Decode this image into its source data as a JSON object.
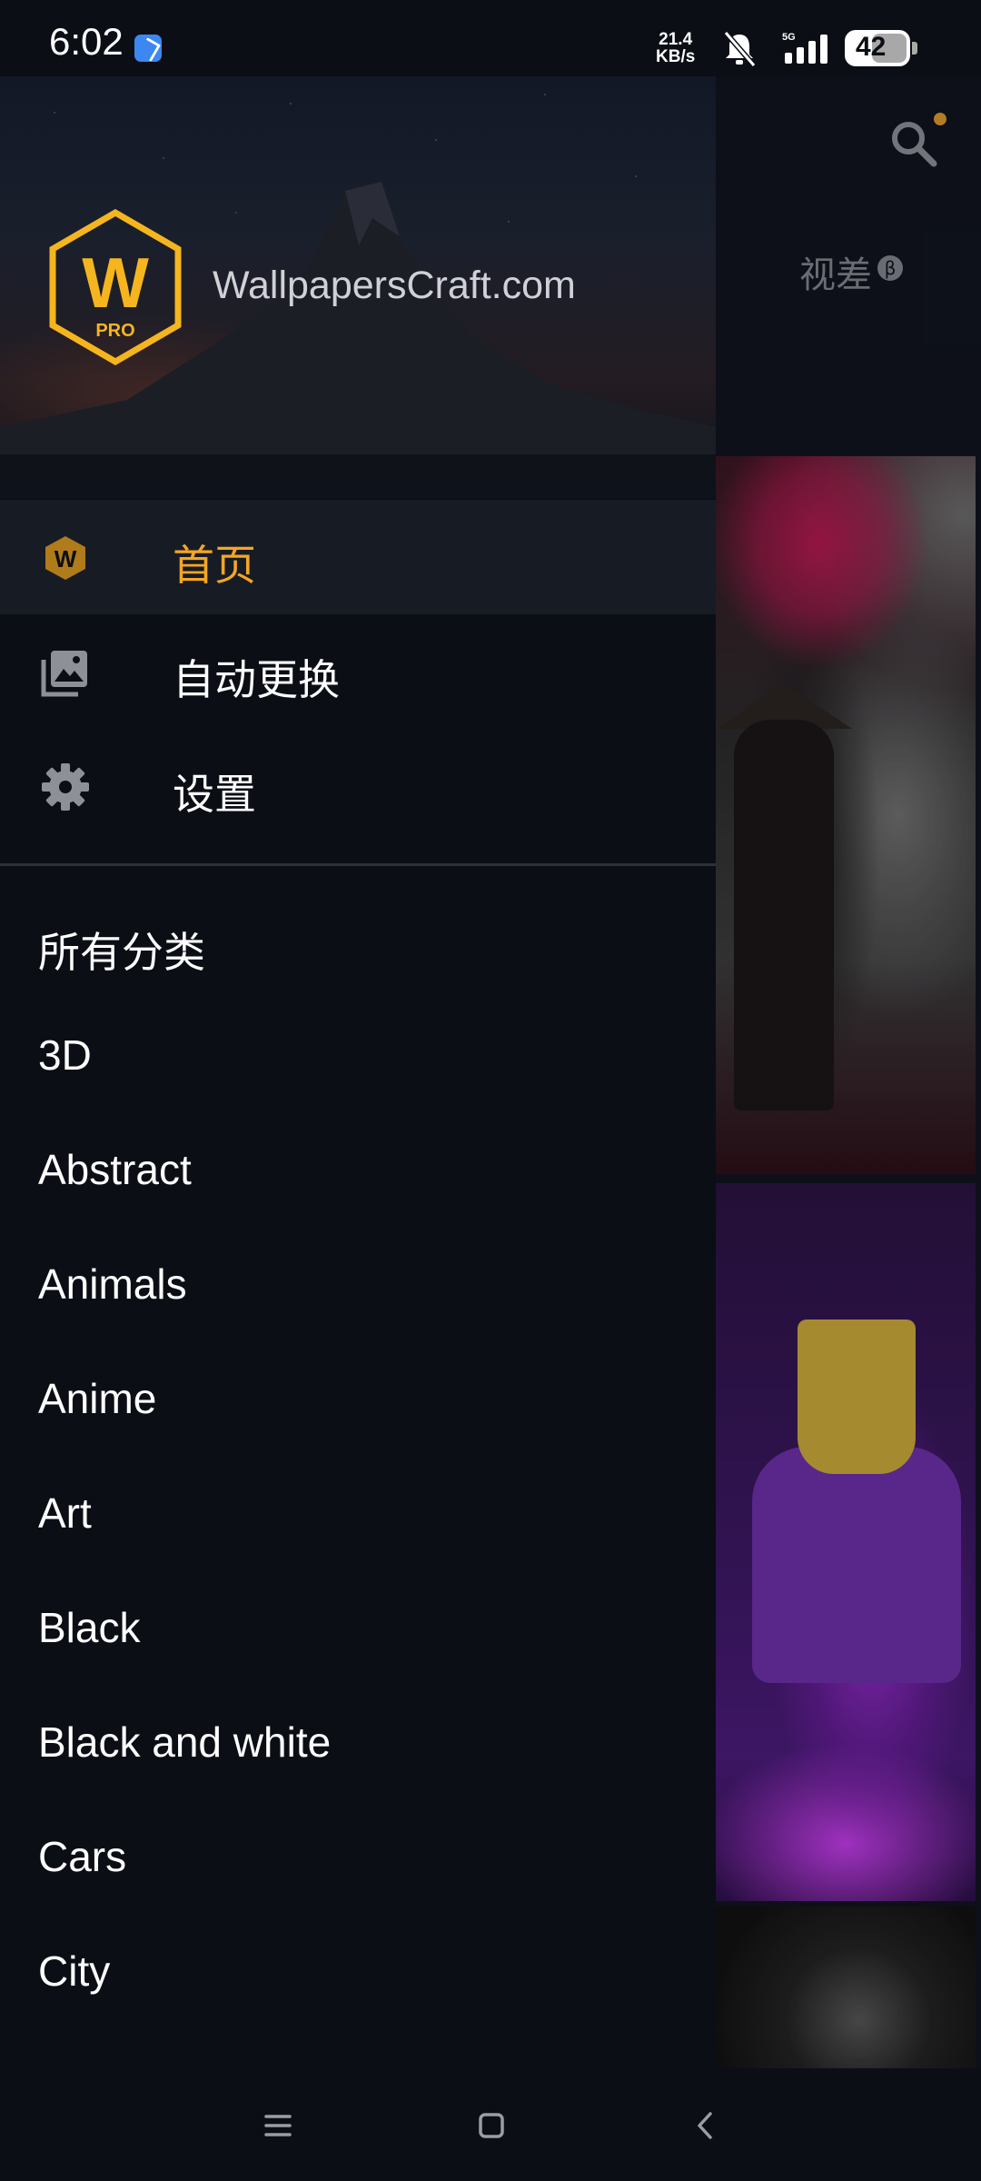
{
  "status_bar": {
    "time": "6:02",
    "net_speed_value": "21.4",
    "net_speed_unit": "KB/s",
    "network": "5G",
    "battery": "42"
  },
  "background": {
    "tab_label": "视差",
    "tab_badge": "β"
  },
  "drawer": {
    "brand": "WallpapersCraft.com",
    "logo_letter": "W",
    "logo_sub": "PRO",
    "menu": [
      {
        "label": "首页",
        "icon": "wallpaperscraft-logo-icon",
        "selected": true
      },
      {
        "label": "自动更换",
        "icon": "photo-library-icon",
        "selected": false
      },
      {
        "label": "设置",
        "icon": "gear-icon",
        "selected": false
      }
    ],
    "categories_title": "所有分类",
    "categories": [
      "3D",
      "Abstract",
      "Animals",
      "Anime",
      "Art",
      "Black",
      "Black and white",
      "Cars",
      "City"
    ]
  },
  "colors": {
    "accent": "#f5a623",
    "background": "#0b0e15",
    "selected_row": "#171b24"
  }
}
